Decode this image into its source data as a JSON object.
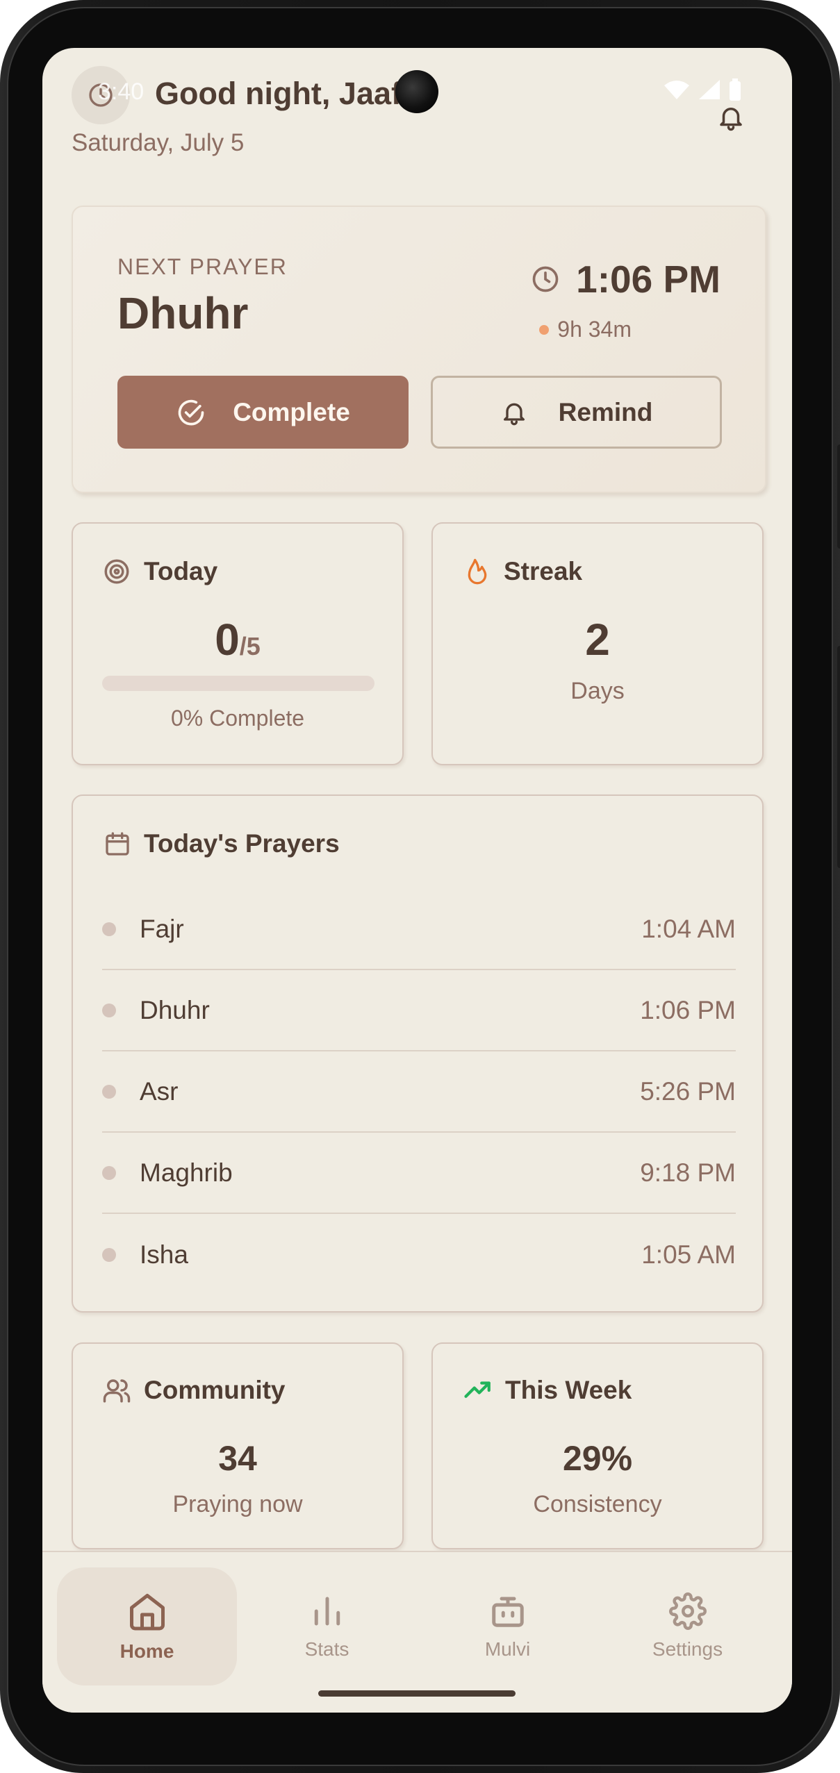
{
  "status_bar": {
    "time": "3:40"
  },
  "header": {
    "greeting": "Good night, Jaafic",
    "date": "Saturday, July 5"
  },
  "next_prayer": {
    "label": "NEXT PRAYER",
    "name": "Dhuhr",
    "time": "1:06 PM",
    "remaining": "9h 34m",
    "complete_label": "Complete",
    "remind_label": "Remind"
  },
  "today": {
    "title": "Today",
    "completed": "0",
    "total": "/5",
    "progress_fraction": 0,
    "percent_text": "0% Complete"
  },
  "streak": {
    "title": "Streak",
    "value": "2",
    "unit": "Days"
  },
  "prayers": {
    "title": "Today's Prayers",
    "items": [
      {
        "name": "Fajr",
        "time": "1:04 AM"
      },
      {
        "name": "Dhuhr",
        "time": "1:06 PM"
      },
      {
        "name": "Asr",
        "time": "5:26 PM"
      },
      {
        "name": "Maghrib",
        "time": "9:18 PM"
      },
      {
        "name": "Isha",
        "time": "1:05 AM"
      }
    ]
  },
  "community": {
    "title": "Community",
    "value": "34",
    "caption": "Praying now"
  },
  "this_week": {
    "title": "This Week",
    "value": "29%",
    "caption": "Consistency"
  },
  "nav": {
    "items": [
      {
        "label": "Home",
        "icon": "home-icon",
        "active": true
      },
      {
        "label": "Stats",
        "icon": "bar-chart-icon",
        "active": false
      },
      {
        "label": "Mulvi",
        "icon": "bot-icon",
        "active": false
      },
      {
        "label": "Settings",
        "icon": "gear-icon",
        "active": false
      }
    ]
  },
  "colors": {
    "background": "#f0ece2",
    "accent": "#a1705f",
    "text_primary": "#4f3d33",
    "text_secondary": "#8c6d62",
    "streak_flame": "#e8772e",
    "trend_green": "#22b35a"
  }
}
